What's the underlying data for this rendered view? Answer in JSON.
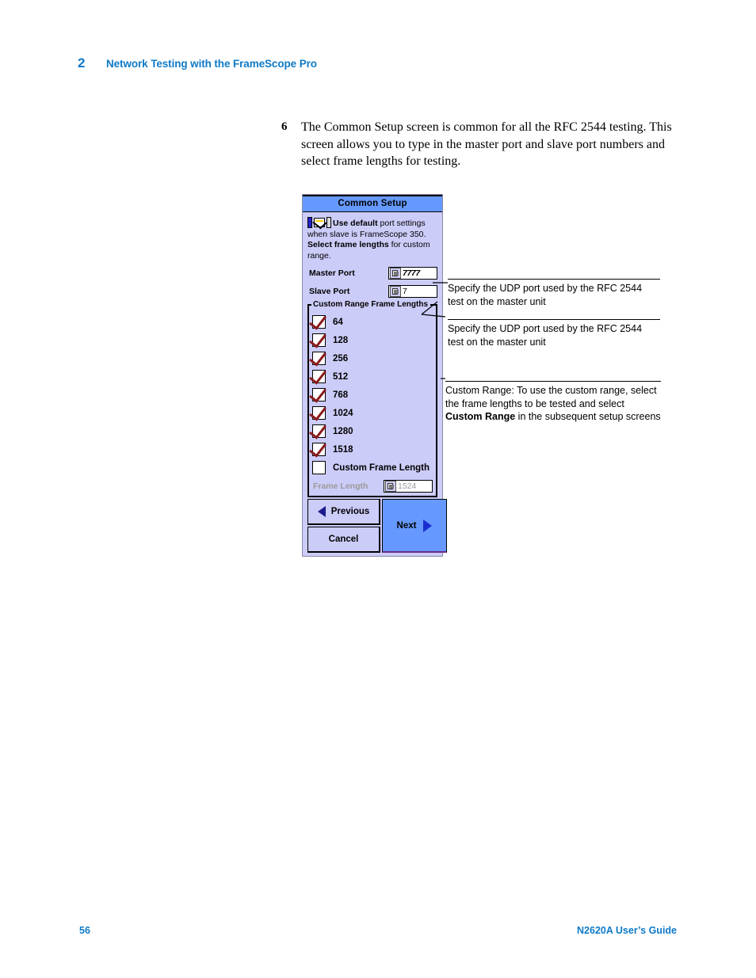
{
  "header": {
    "chapter_number": "2",
    "chapter_title": "Network Testing with the FrameScope Pro",
    "accent_color": "#0f7ac7"
  },
  "step": {
    "number": "6",
    "text": "The Common Setup screen is common for all the RFC 2544 testing. This screen allows you to type in the master port and slave port numbers and select frame lengths for testing."
  },
  "device_screen": {
    "title": "Common Setup",
    "title_bar_color": "#6699ff",
    "body_color": "#ccccf9",
    "tip": {
      "icon": "port-settings-icon",
      "segment_1": "Use default",
      "segment_2": " port settings when slave is FrameScope 350. ",
      "segment_3": "Select frame lengths",
      "segment_4": " for custom range."
    },
    "fields": [
      {
        "label": "Master Port",
        "value": "7777",
        "style": "italic",
        "disabled": false
      },
      {
        "label": "Slave Port",
        "value": "7",
        "style": "normal",
        "disabled": false
      }
    ],
    "group": {
      "legend": "Custom Range Frame Lengths",
      "checkboxes": [
        {
          "label": "64",
          "checked": true
        },
        {
          "label": "128",
          "checked": true
        },
        {
          "label": "256",
          "checked": true
        },
        {
          "label": "512",
          "checked": true
        },
        {
          "label": "768",
          "checked": true
        },
        {
          "label": "1024",
          "checked": true
        },
        {
          "label": "1280",
          "checked": true
        },
        {
          "label": "1518",
          "checked": true
        },
        {
          "label": "Custom Frame Length",
          "checked": false
        }
      ],
      "frame_length_field": {
        "label": "Frame Length",
        "value": "1524",
        "disabled": true
      }
    },
    "buttons": {
      "previous": "Previous",
      "cancel": "Cancel",
      "next": "Next"
    }
  },
  "callouts": [
    {
      "text": "Specify the UDP port used by the RFC 2544 test on the master unit"
    },
    {
      "text": "Specify the UDP port used by the RFC 2544 test on the master unit"
    },
    {
      "part_1": "Custom Range: To use the custom range, select the frame lengths to be tested and select ",
      "bold": "Custom Range",
      "part_2": " in the subsequent setup screens"
    }
  ],
  "footer": {
    "page_number": "56",
    "guide_title": "N2620A User’s Guide"
  }
}
